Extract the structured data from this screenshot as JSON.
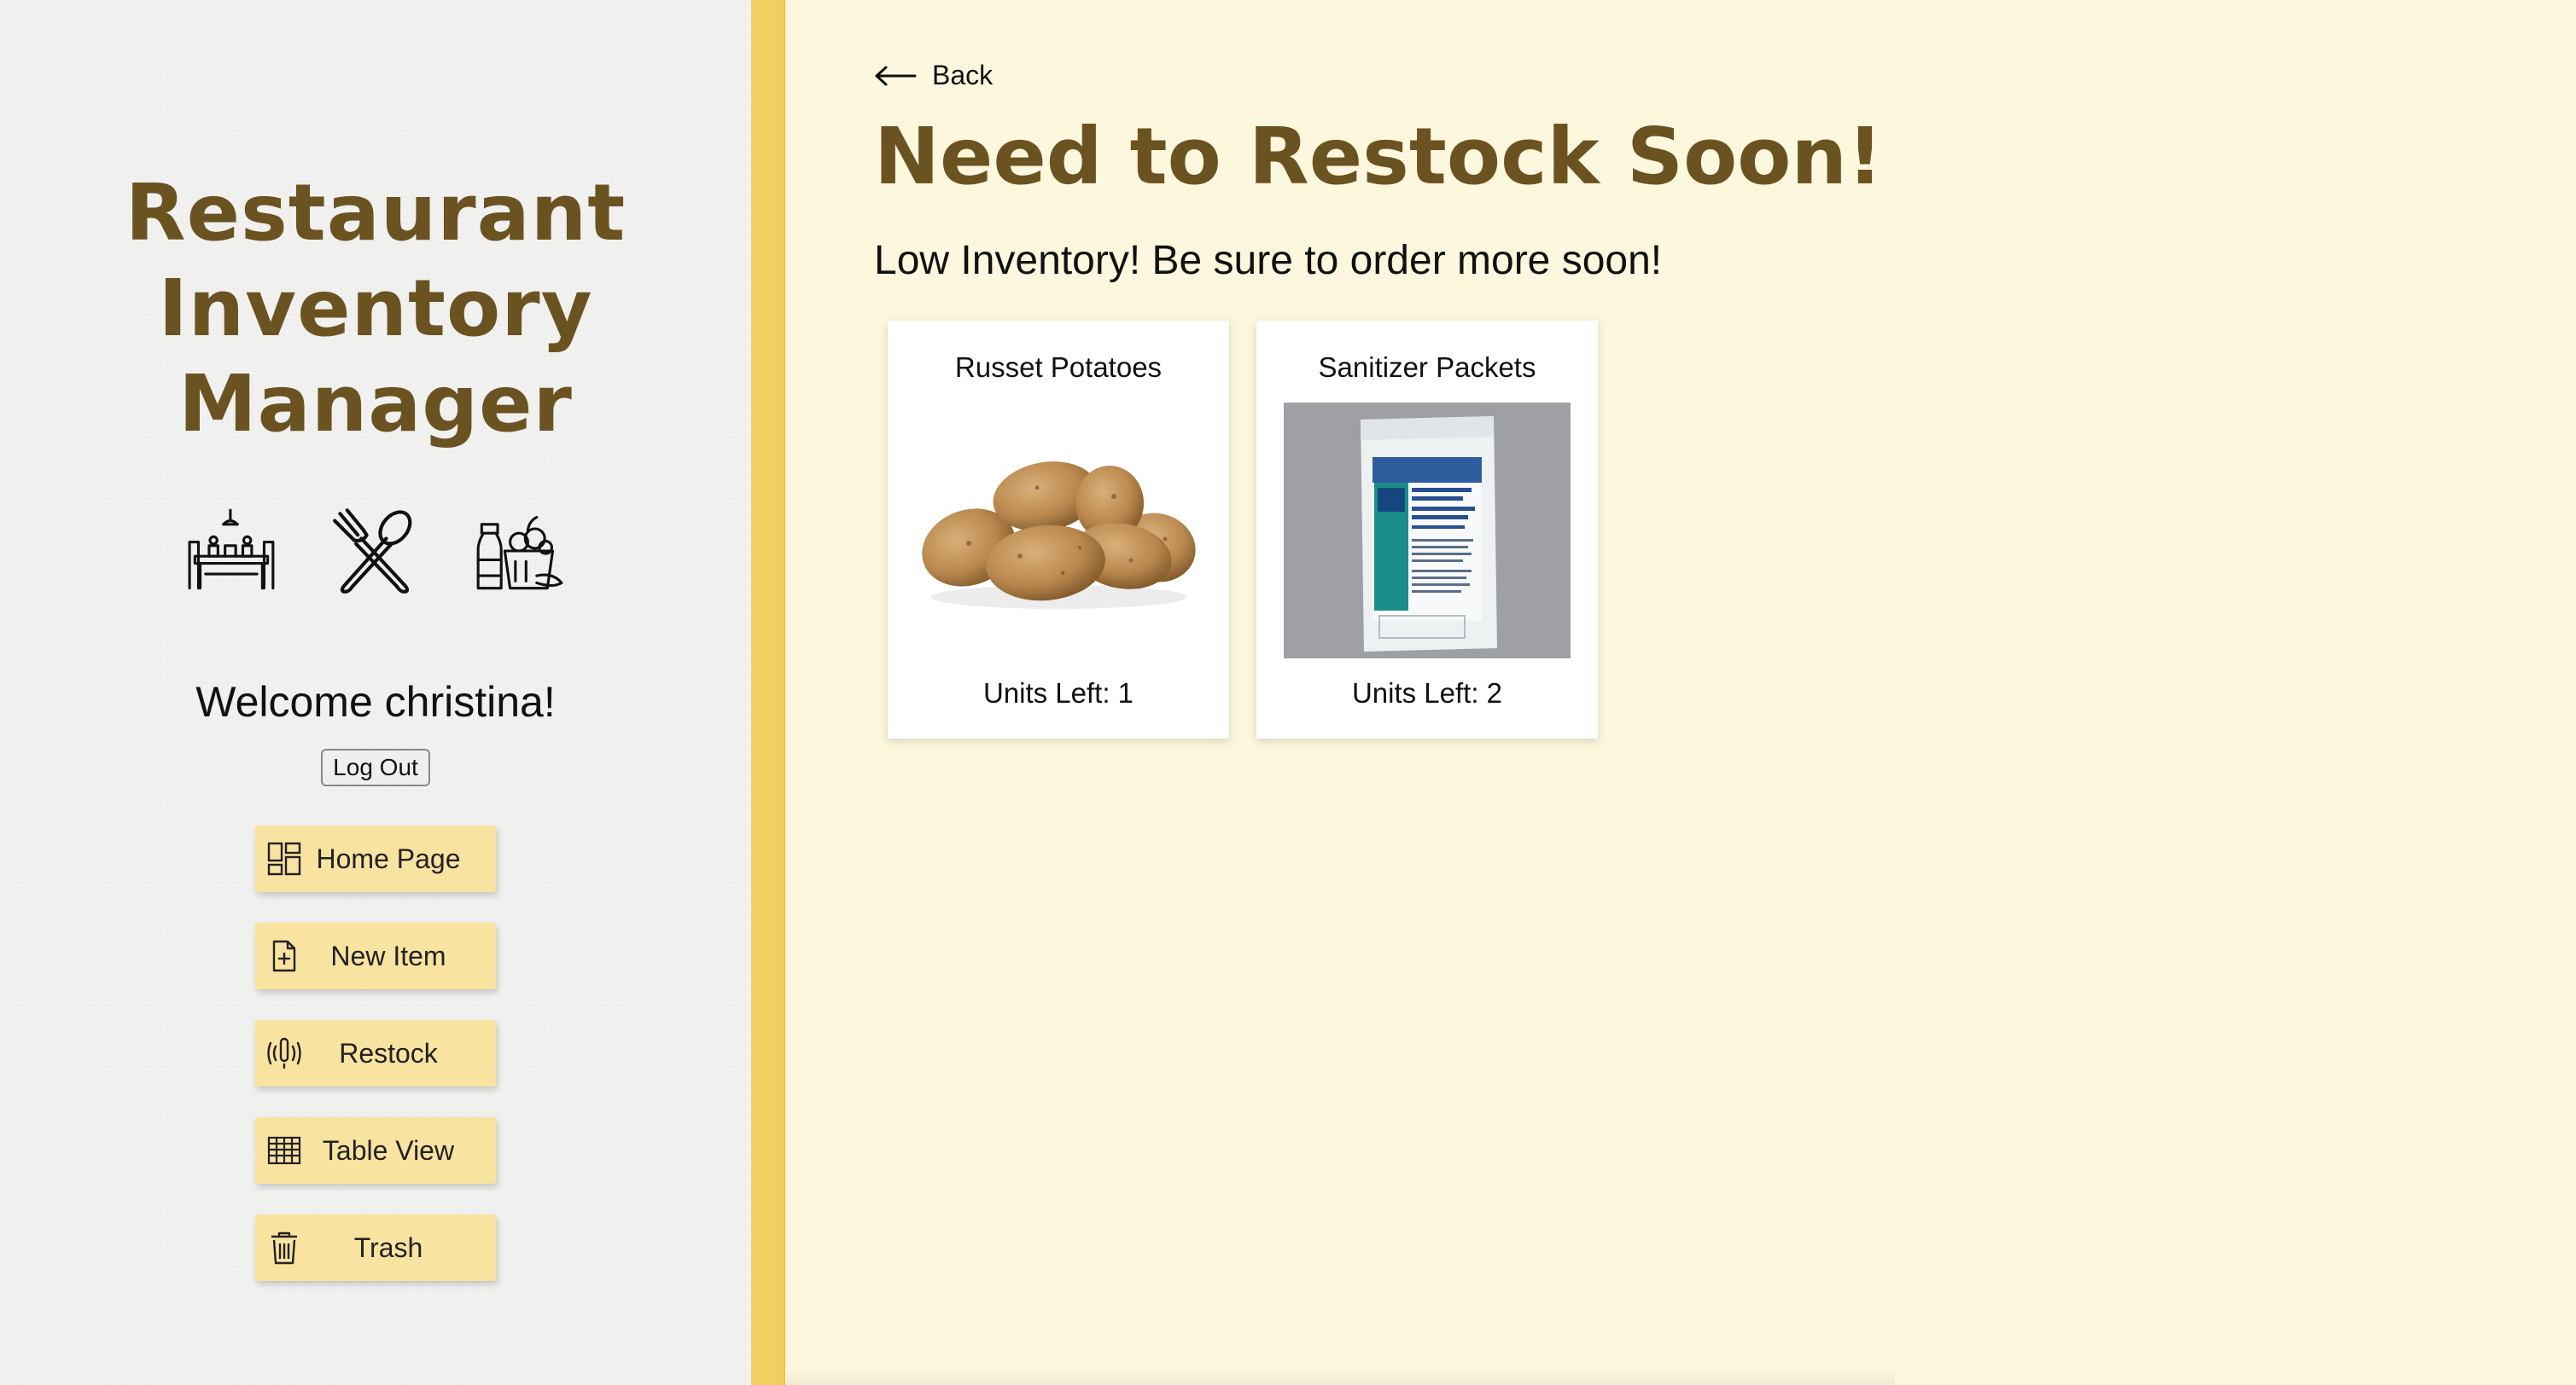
{
  "sidebar": {
    "app_title": "Restaurant Inventory Manager",
    "icons": [
      "dining-table-icon",
      "fork-spoon-icon",
      "groceries-icon"
    ],
    "welcome_text": "Welcome christina!",
    "logout_label": "Log Out",
    "nav": [
      {
        "label": "Home Page",
        "icon": "dashboard-icon"
      },
      {
        "label": "New Item",
        "icon": "add-file-icon"
      },
      {
        "label": "Restock",
        "icon": "alert-icon"
      },
      {
        "label": "Table View",
        "icon": "table-icon"
      },
      {
        "label": "Trash",
        "icon": "trash-icon"
      }
    ]
  },
  "main": {
    "back_label": "Back",
    "title": "Need to Restock Soon!",
    "subtitle": "Low Inventory! Be sure to order more soon!",
    "items": [
      {
        "name": "Russet Potatoes",
        "units": "Units Left: 1"
      },
      {
        "name": "Sanitizer Packets",
        "units": "Units Left: 2"
      }
    ]
  },
  "colors": {
    "sidebar_bg": "#f1f1f0",
    "accent_yellow": "#f2cf63",
    "nav_button": "#f9e3a0",
    "title_brown": "#6b5321",
    "main_bg": "#fdf7de"
  }
}
